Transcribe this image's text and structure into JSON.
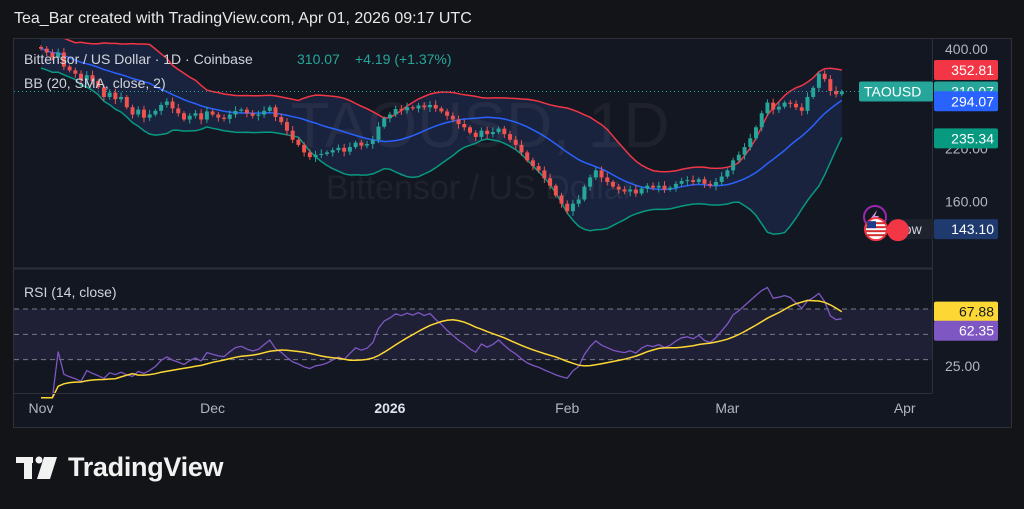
{
  "header": {
    "attribution": "Tea_Bar created with TradingView.com, Apr 01, 2026 09:17 UTC"
  },
  "legend": {
    "symbol": "Bittensor / US Dollar · 1D · Coinbase",
    "price": "310.07",
    "change": "+4.19 (+1.37%)",
    "bb": "BB (20, SMA, close, 2)",
    "rsi": "RSI (14, close)"
  },
  "watermark": {
    "line1": "TAOUSD, 1D",
    "line2": "Bittensor / US Dollar"
  },
  "brand": {
    "name": "TradingView",
    "icon": "tradingview-logo-icon"
  },
  "price_tags": {
    "bb_upper": "352.81",
    "symbol_name": "TAOUSD",
    "last_price": "310.07",
    "bb_basis": "294.07",
    "bb_lower": "235.34",
    "low_label": "Low",
    "low_value": "143.10"
  },
  "rsi_tags": {
    "rsi_ma": "67.88",
    "rsi": "62.35"
  },
  "colors": {
    "up": "#26a69a",
    "down": "#ef5350",
    "basis": "#2962ff",
    "upper": "#f23645",
    "lower": "#089981",
    "rsi": "#7e57c2",
    "rsi_ma": "#fdd835",
    "band_fill": "#1c2642"
  },
  "icons": [
    "lightning-icon",
    "us-flag-icon"
  ],
  "chart_data": {
    "type": "candlestick",
    "price_axis": {
      "scale": "log",
      "ylim": [
        108,
        425
      ],
      "ticks": [
        "400.00",
        "220.00",
        "160.00"
      ]
    },
    "time_axis": {
      "labels": [
        "Nov",
        "Dec",
        "2026",
        "Feb",
        "Mar",
        "Apr"
      ],
      "label_days": [
        0,
        30,
        61,
        92,
        120,
        151
      ]
    },
    "close": [
      401,
      392,
      380,
      392,
      360,
      352,
      345,
      332,
      342,
      330,
      318,
      300,
      308,
      296,
      300,
      282,
      270,
      278,
      265,
      270,
      276,
      286,
      292,
      280,
      272,
      262,
      268,
      272,
      262,
      275,
      270,
      265,
      263,
      270,
      276,
      278,
      272,
      268,
      270,
      276,
      282,
      266,
      258,
      245,
      232,
      225,
      215,
      209,
      212,
      213,
      215,
      218,
      221,
      216,
      222,
      228,
      224,
      226,
      232,
      251,
      264,
      270,
      279,
      277,
      282,
      280,
      285,
      282,
      286,
      280,
      275,
      268,
      262,
      255,
      250,
      242,
      236,
      245,
      240,
      243,
      248,
      240,
      232,
      225,
      215,
      205,
      198,
      193,
      184,
      176,
      166,
      158,
      151,
      158,
      162,
      175,
      185,
      193,
      185,
      180,
      175,
      172,
      170,
      172,
      168,
      173,
      176,
      174,
      176,
      172,
      174,
      178,
      181,
      182,
      180,
      183,
      178,
      176,
      180,
      186,
      193,
      205,
      212,
      222,
      234,
      250,
      272,
      290,
      278,
      283,
      290,
      288,
      282,
      276,
      300,
      317,
      345,
      334,
      311,
      305,
      310
    ],
    "bollinger": {
      "period": 20,
      "mult": 2,
      "upper_last": 352.81,
      "basis_last": 294.07,
      "lower_last": 235.34
    },
    "rsi": {
      "period": 14,
      "ylim": [
        10,
        100
      ],
      "levels": [
        70,
        50,
        30
      ],
      "ticks": [
        "50.00",
        "25.00"
      ],
      "rsi_last": 62.35,
      "ma_last": 67.88
    },
    "last_price": 310.07,
    "low": 143.1
  }
}
